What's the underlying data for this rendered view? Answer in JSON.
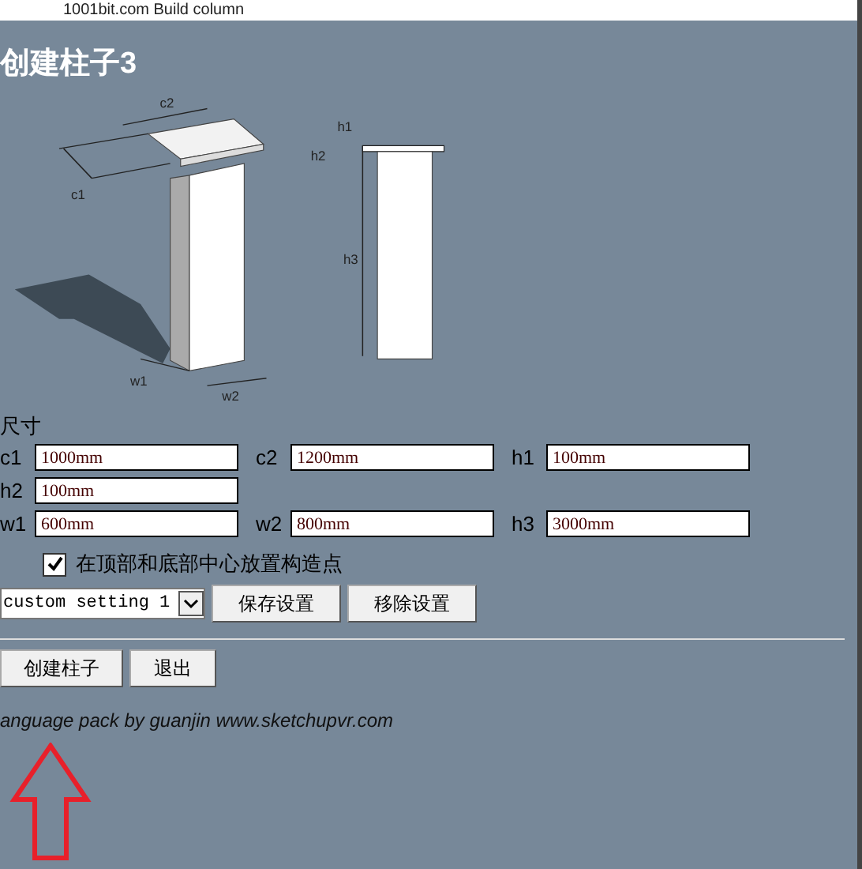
{
  "window": {
    "title": "1001bit.com Build column"
  },
  "heading": "创建柱子3",
  "diagram": {
    "labels": [
      "c1",
      "c2",
      "w1",
      "w2",
      "h1",
      "h2",
      "h3"
    ]
  },
  "section_label": "尺寸",
  "fields": [
    {
      "label": "c1",
      "value": "1000mm"
    },
    {
      "label": "c2",
      "value": "1200mm"
    },
    {
      "label": "h1",
      "value": "100mm"
    },
    {
      "label": "h2",
      "value": "100mm"
    },
    {
      "label": "w1",
      "value": "600mm"
    },
    {
      "label": "w2",
      "value": "800mm"
    },
    {
      "label": "h3",
      "value": "3000mm"
    }
  ],
  "checkbox": {
    "label": "在顶部和底部中心放置构造点",
    "checked": true
  },
  "preset": {
    "value": "custom setting 1",
    "buttons": [
      "保存设置",
      "移除设置"
    ]
  },
  "actions": [
    "创建柱子",
    "退出"
  ],
  "footer": "anguage pack by guanjin www.sketchupvr.com"
}
